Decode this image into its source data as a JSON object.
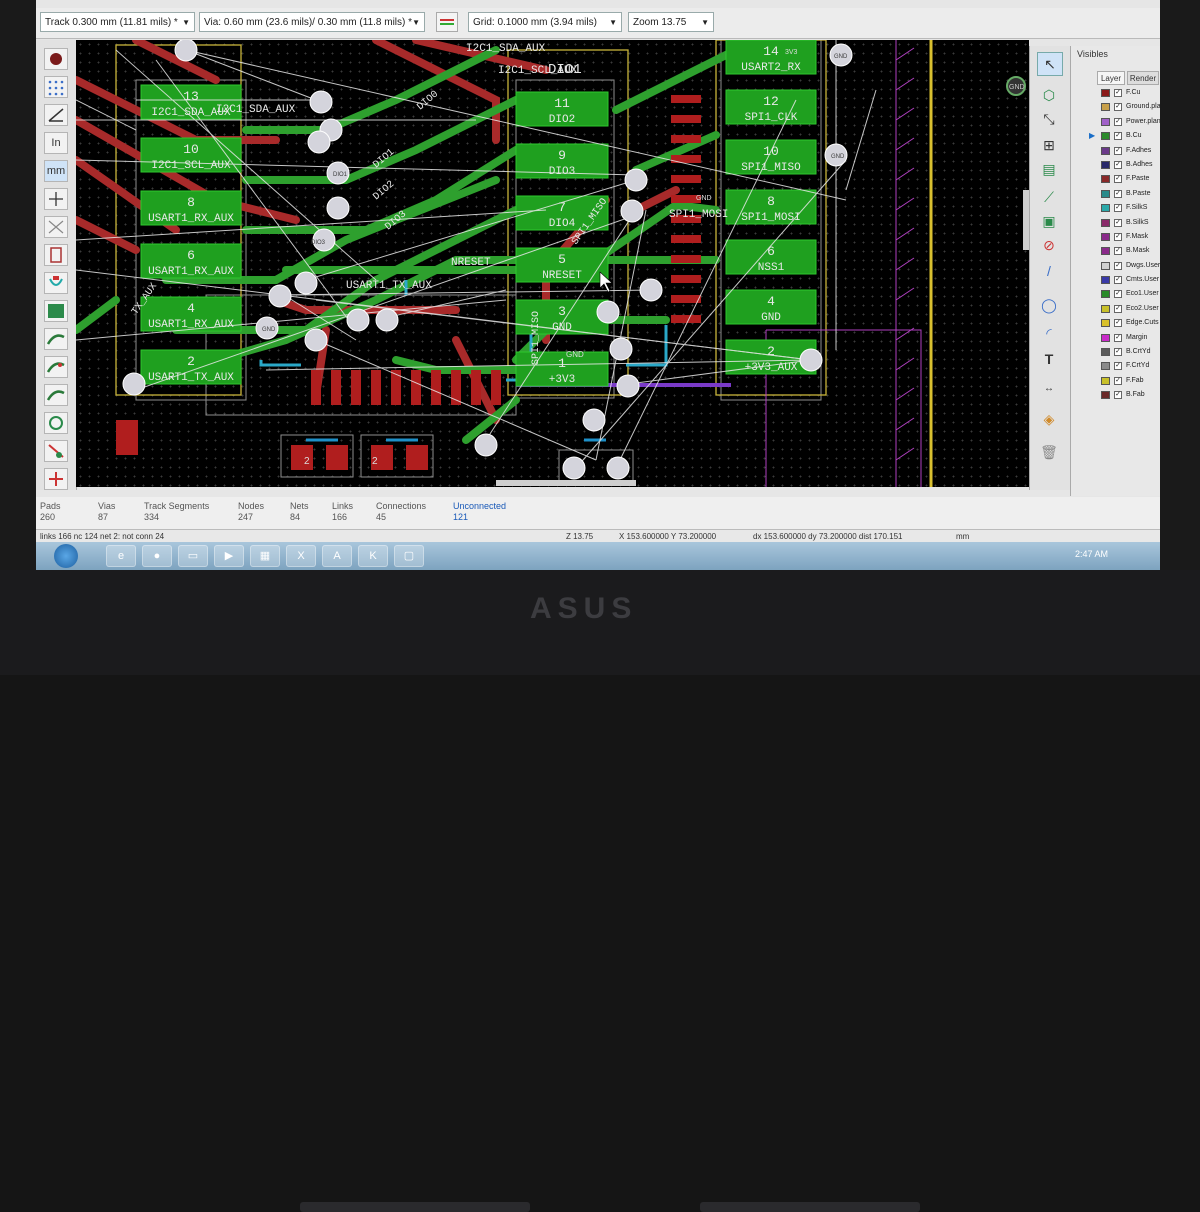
{
  "toolbar": {
    "track": "Track 0.300 mm (11.81 mils) *",
    "via": "Via: 0.60 mm (23.6 mils)/ 0.30 mm (11.8 mils) *",
    "grid": "Grid: 0.1000 mm (3.94 mils)",
    "zoom": "Zoom 13.75"
  },
  "pcb": {
    "pads_left": [
      {
        "num": "13",
        "net": "I2C1_SDA_AUX"
      },
      {
        "num": "10",
        "net": "I2C1_SCL_AUX"
      },
      {
        "num": "8",
        "net": "USART1_RX_AUX"
      },
      {
        "num": "6",
        "net": "USART1_RX_AUX"
      },
      {
        "num": "4",
        "net": "USART1_RX_AUX"
      },
      {
        "num": "2",
        "net": "USART1_TX_AUX"
      }
    ],
    "pads_mid": [
      {
        "num": "11",
        "net": "DIO2"
      },
      {
        "num": "9",
        "net": "DIO3"
      },
      {
        "num": "7",
        "net": "DIO4"
      },
      {
        "num": "5",
        "net": "NRESET"
      },
      {
        "num": "3",
        "net": "GND"
      },
      {
        "num": "1",
        "net": "+3V3"
      }
    ],
    "pads_right": [
      {
        "num": "14",
        "net": "USART2_RX"
      },
      {
        "num": "12",
        "net": "SPI1_CLK"
      },
      {
        "num": "10",
        "net": "SPI1_MISO"
      },
      {
        "num": "8",
        "net": "SPI1_MOSI"
      },
      {
        "num": "6",
        "net": "NSS1"
      },
      {
        "num": "4",
        "net": "GND"
      },
      {
        "num": "2",
        "net": "+3V3_AUX"
      }
    ],
    "labels": {
      "i2c_sda_top": "I2C1_SDA_AUX",
      "i2c_scl_top": "I2C1_SCL_AUX",
      "dio1": "DIO1",
      "i2c_sda_left": "I2C1_SDA_AUX",
      "dio0": "DIO0",
      "dio1b": "DIO1",
      "dio2": "DIO2",
      "dio3": "DIO3",
      "spi1_miso_diag": "SPI1_MISO",
      "spi1_mosi": "SPI1_MOSI",
      "nreset": "NRESET",
      "usart_tx": "USART1_TX_AUX",
      "spi1_miso_vert": "SPI1_MISO",
      "gnd_right": "GND",
      "gnd_top": "GND",
      "gnd_mid": "GND",
      "usart2_rx_top": "3V3",
      "usart_aux_left": "TX_AUX",
      "pad_2a": "2",
      "pad_2b": "2"
    }
  },
  "visibles": {
    "title": "Visibles",
    "tabs": [
      "Layer",
      "Render"
    ],
    "layers": [
      {
        "name": "F.Cu",
        "color": "#8b1a1a",
        "active": false
      },
      {
        "name": "Ground.plane",
        "color": "#c8a04a",
        "active": false
      },
      {
        "name": "Power.plane",
        "color": "#a060c8",
        "active": false
      },
      {
        "name": "B.Cu",
        "color": "#2b8a2b",
        "active": true
      },
      {
        "name": "F.Adhes",
        "color": "#6b3a8a",
        "active": false
      },
      {
        "name": "B.Adhes",
        "color": "#2a2a6a",
        "active": false
      },
      {
        "name": "F.Paste",
        "color": "#8a2a2a",
        "active": false
      },
      {
        "name": "B.Paste",
        "color": "#2a8a8a",
        "active": false
      },
      {
        "name": "F.SilkS",
        "color": "#2aa8a8",
        "active": false
      },
      {
        "name": "B.SilkS",
        "color": "#8a2a6a",
        "active": false
      },
      {
        "name": "F.Mask",
        "color": "#8a2a8a",
        "active": false
      },
      {
        "name": "B.Mask",
        "color": "#8a2a8a",
        "active": false
      },
      {
        "name": "Dwgs.User",
        "color": "#d0d0d0",
        "active": false
      },
      {
        "name": "Cmts.User",
        "color": "#3a3aa8",
        "active": false
      },
      {
        "name": "Eco1.User",
        "color": "#2a8a2a",
        "active": false
      },
      {
        "name": "Eco2.User",
        "color": "#c8c02a",
        "active": false
      },
      {
        "name": "Edge.Cuts",
        "color": "#d8c02a",
        "active": false
      },
      {
        "name": "Margin",
        "color": "#c82ac8",
        "active": false
      },
      {
        "name": "B.CrtYd",
        "color": "#5a5a5a",
        "active": false
      },
      {
        "name": "F.CrtYd",
        "color": "#8a8a8a",
        "active": false
      },
      {
        "name": "F.Fab",
        "color": "#c8c02a",
        "active": false
      },
      {
        "name": "B.Fab",
        "color": "#6a2a2a",
        "active": false
      }
    ]
  },
  "stats": [
    {
      "label": "Pads",
      "value": "260"
    },
    {
      "label": "Vias",
      "value": "87"
    },
    {
      "label": "Track Segments",
      "value": "334"
    },
    {
      "label": "Nodes",
      "value": "247"
    },
    {
      "label": "Nets",
      "value": "84"
    },
    {
      "label": "Links",
      "value": "166"
    },
    {
      "label": "Connections",
      "value": "45"
    },
    {
      "label": "Unconnected",
      "value": "121"
    }
  ],
  "statusline": {
    "info": "links 166 nc 124  net 2: not conn 24",
    "zoom": "Z 13.75",
    "xy": "X 153.600000  Y 73.200000",
    "dxy": "dx 153.600000  dy 73.200000  dist 170.151",
    "units": "mm"
  },
  "taskbar": {
    "clock": "2:47 AM"
  },
  "brand": "ASUS"
}
